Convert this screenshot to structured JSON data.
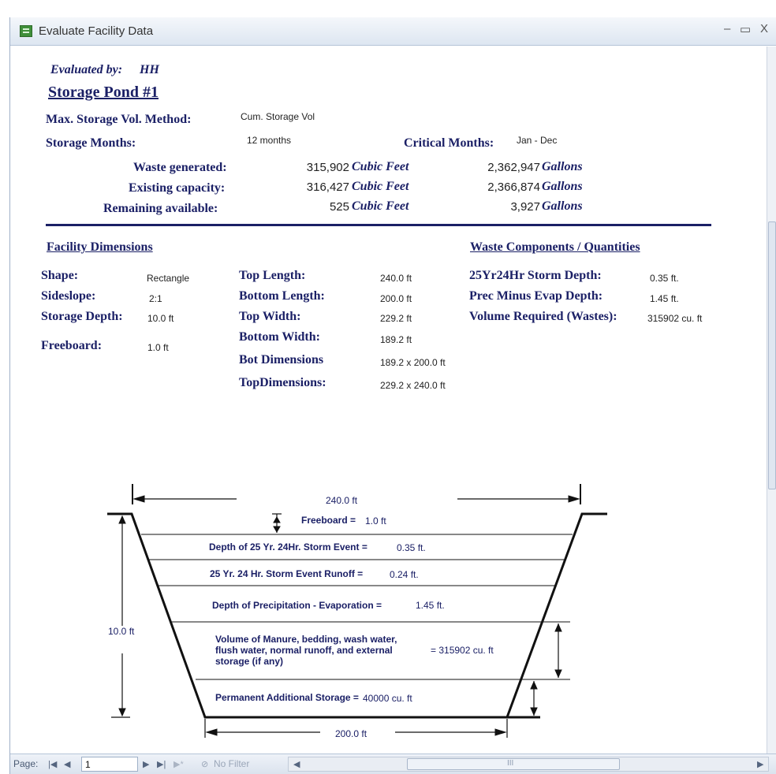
{
  "window": {
    "title": "Evaluate Facility Data",
    "minimize": "–",
    "maximize": "▭",
    "close": "X"
  },
  "report": {
    "evaluated_by_label": "Evaluated by:",
    "evaluated_by_value": "HH",
    "pond_title": "Storage Pond #1",
    "method_label": "Max. Storage Vol. Method:",
    "method_value": "Cum. Storage Vol",
    "storage_months_label": "Storage Months:",
    "storage_months_value": "12 months",
    "critical_months_label": "Critical Months:",
    "critical_months_value": "Jan - Dec",
    "volumes": [
      {
        "label": "Waste generated:",
        "cubic": "315,902",
        "cubic_unit": "Cubic Feet",
        "gallons": "2,362,947",
        "gallons_unit": "Gallons"
      },
      {
        "label": "Existing capacity:",
        "cubic": "316,427",
        "cubic_unit": "Cubic Feet",
        "gallons": "2,366,874",
        "gallons_unit": "Gallons"
      },
      {
        "label": "Remaining available:",
        "cubic": "525",
        "cubic_unit": "Cubic Feet",
        "gallons": "3,927",
        "gallons_unit": "Gallons"
      }
    ],
    "facility_dimensions_title": "Facility Dimensions",
    "waste_components_title": "Waste Components / Quantities",
    "dims_left": [
      {
        "label": "Shape:",
        "value": "Rectangle"
      },
      {
        "label": "Sideslope:",
        "value": "2:1"
      },
      {
        "label": "Storage Depth:",
        "value": "10.0 ft"
      },
      {
        "label": "Freeboard:",
        "value": "1.0 ft"
      }
    ],
    "dims_mid": [
      {
        "label": "Top Length:",
        "value": "240.0 ft"
      },
      {
        "label": "Bottom Length:",
        "value": "200.0 ft"
      },
      {
        "label": "Top Width:",
        "value": "229.2 ft"
      },
      {
        "label": "Bottom Width:",
        "value": "189.2 ft"
      },
      {
        "label": "Bot Dimensions",
        "value": "189.2 x 200.0 ft"
      },
      {
        "label": "TopDimensions:",
        "value": "229.2 x 240.0 ft"
      }
    ],
    "waste": [
      {
        "label": "25Yr24Hr Storm Depth:",
        "value": "0.35 ft."
      },
      {
        "label": "Prec Minus Evap Depth:",
        "value": "1.45 ft."
      },
      {
        "label": "Volume Required (Wastes):",
        "value": "315902 cu. ft"
      }
    ]
  },
  "diagram": {
    "top_length": "240.0 ft",
    "bottom_length": "200.0 ft",
    "depth": "10.0 ft",
    "freeboard_label": "Freeboard =",
    "freeboard_value": "1.0 ft",
    "storm_depth_label": "Depth of 25 Yr. 24Hr. Storm Event =",
    "storm_depth_value": "0.35 ft.",
    "storm_runoff_label": "25 Yr. 24 Hr. Storm Event Runoff =",
    "storm_runoff_value": "0.24 ft.",
    "precip_label": "Depth of Precipitation - Evaporation =",
    "precip_value": "1.45 ft.",
    "volume_label_1": "Volume of Manure, bedding, wash water,",
    "volume_label_2": "flush water, normal runoff, and external",
    "volume_label_3": "storage (if any)",
    "volume_value": "= 315902 cu. ft",
    "permanent_label": "Permanent Additional Storage =",
    "permanent_value": "40000 cu. ft"
  },
  "statusbar": {
    "page_label": "Page:",
    "page_value": "1",
    "filter_label": "No Filter",
    "scroll_grip": "III"
  },
  "colors": {
    "label_text": "#1b2066",
    "rule": "#1b2066",
    "diagram_text": "#1b2066"
  }
}
